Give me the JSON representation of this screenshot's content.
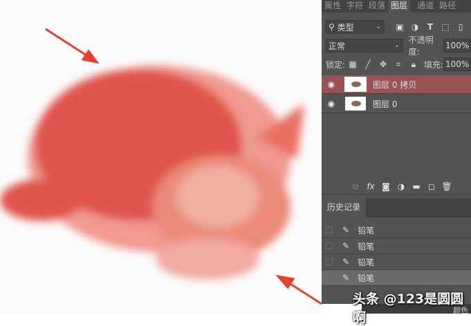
{
  "panel_tabs": [
    "属性",
    "字符",
    "段落",
    "图层",
    "通道",
    "路径"
  ],
  "active_tab": "图层",
  "filter": {
    "label": "类型"
  },
  "blend_mode": "正常",
  "opacity": {
    "label": "不透明度:",
    "value": "100%"
  },
  "lock": {
    "label": "锁定:"
  },
  "fill": {
    "label": "填充:",
    "value": "100%"
  },
  "layers": [
    {
      "name": "图层 0 拷贝",
      "selected": true
    },
    {
      "name": "图层 0",
      "selected": false
    }
  ],
  "history": {
    "tab": "历史记录",
    "items": [
      "铅笔",
      "铅笔",
      "铅笔",
      "铅笔"
    ]
  },
  "watermark": "头条 @123是圆圆啊",
  "bottom_tab": "颜色",
  "colors": {
    "selected_layer": "#9b5252",
    "arrow": "#e8402a",
    "cat_tint": "#e0504a"
  }
}
